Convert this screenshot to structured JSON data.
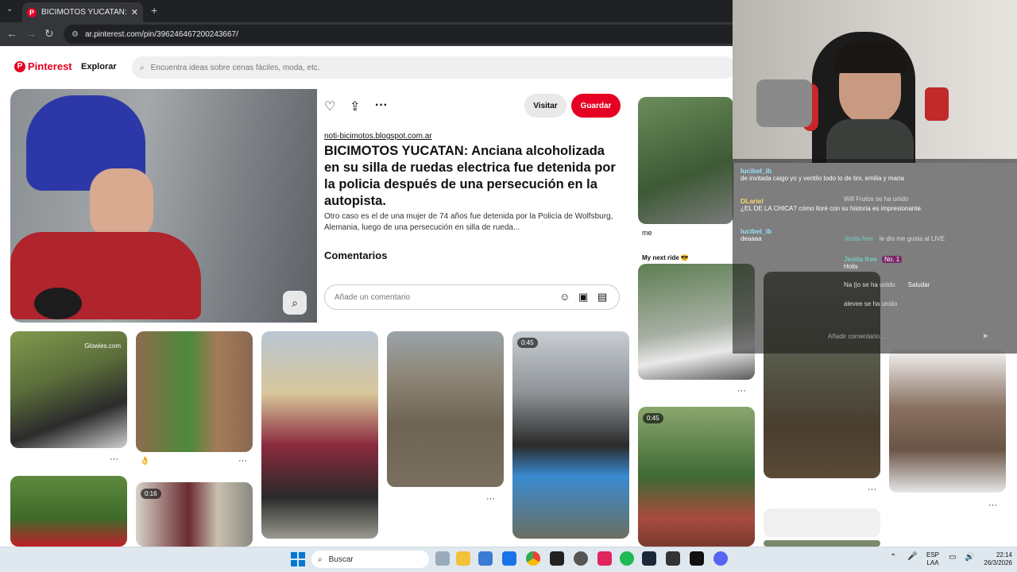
{
  "browser": {
    "tab_title": "BICIMOTOS YUCATAN: Anciana",
    "url": "ar.pinterest.com/pin/396246467200243667/"
  },
  "header": {
    "logo": "Pinterest",
    "explore": "Explorar",
    "search_placeholder": "Encuentra ideas sobre cenas fáciles, moda, etc."
  },
  "pin": {
    "visit_label": "Visitar",
    "save_label": "Guardar",
    "source": "noti-bicimotos.blogspot.com.ar",
    "title": "BICIMOTOS YUCATAN: Anciana alcoholizada en su silla de ruedas electrica fue detenida por la policia después de una persecución en la autopista.",
    "description": "Otro caso es el de una mujer de 74 años fue detenida por la Policía de Wolfsburg, Alemania, luego de una persecución en silla de rueda...",
    "comments_heading": "Comentarios",
    "comment_placeholder": "Añade un comentario"
  },
  "grid": {
    "tile1_watermark": "Glowies.com",
    "tile_duration_a": "0:45",
    "tile_duration_b": "0:16",
    "tile_duration_c": "0:45",
    "caption_me": "me",
    "caption_next_ride": "My next ride 😎",
    "emoji_caption": "👌"
  },
  "chat": {
    "messages": [
      {
        "user": "lucibel_ib",
        "text": "de invitada caigo yo y ventilo todo lo de tini, emilia y maria"
      },
      {
        "user": "",
        "text": "Will Frutos se ha unido"
      },
      {
        "user": "DLariel",
        "text": "¿EL DE LA CHICA? cómo lloré con su historia es impresionante."
      },
      {
        "user": "lucibel_ib",
        "text": "deaaaa"
      },
      {
        "user": "Jesita free",
        "text": "le dio me gusta al LIVE"
      },
      {
        "user": "Jesita free",
        "text": "Holis"
      },
      {
        "user": "",
        "text": "Na ||o se ha unido"
      },
      {
        "user": "",
        "text": "alevee se ha unido"
      }
    ],
    "badge_no1": "No. 1",
    "greet_label": "Saludar",
    "input_placeholder": "Añadir comentario..."
  },
  "taskbar": {
    "search_label": "Buscar",
    "lang_top": "ESP",
    "lang_bottom": "LAA",
    "time": "22:14",
    "date": "26/3/2026"
  },
  "colors": {
    "brand": "#e60023"
  }
}
